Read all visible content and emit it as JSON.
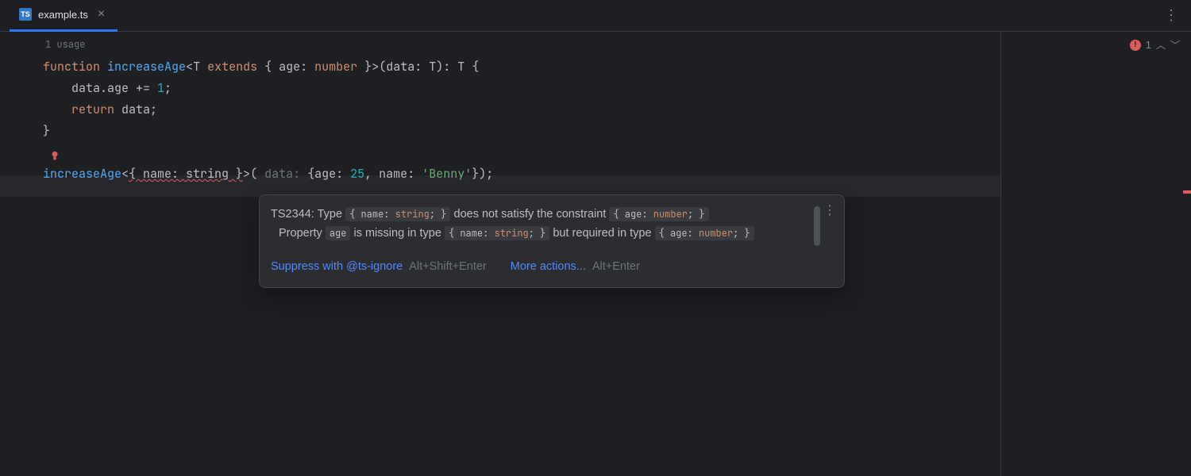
{
  "tab": {
    "icon_label": "TS",
    "filename": "example.ts"
  },
  "editor": {
    "usage_hint": "1 usage",
    "code": {
      "kw_function": "function",
      "fn_name": "increaseAge",
      "generic_open": "<",
      "T": "T",
      "kw_extends": "extends",
      "constraint_open": "{ ",
      "age_label": "age",
      "colon": ": ",
      "number_type": "number",
      "constraint_close": " }",
      "generic_close": ">",
      "params": "(data: ",
      "param_T": "T",
      "ret": "): ",
      "ret_T": "T",
      "brace_open": " {",
      "line2": "    data.age += ",
      "one": "1",
      "semi": ";",
      "line3_kw": "    return",
      "line3_rest": " data;",
      "brace_close": "}",
      "call_fn": "increaseAge",
      "call_generic_open": "<",
      "err_type": "{ name: string }",
      "call_generic_close": ">",
      "call_paren_open": "(",
      "inlay_data": " data: ",
      "obj_open": "{",
      "age_key": "age",
      "age_val": "25",
      "comma": ", ",
      "name_key": "name",
      "name_val": "'Benny'",
      "obj_close": "}",
      "call_close": ");"
    }
  },
  "rail": {
    "error_count": "1",
    "err_symbol": "!"
  },
  "popup": {
    "err_code": "TS2344",
    "msg1a": ": Type ",
    "chip1": "{ name: ",
    "chip1_kw": "string",
    "chip1_end": "; }",
    "msg1b": " does not satisfy the constraint ",
    "chip2": "{ age: ",
    "chip2_kw": "number",
    "chip2_end": "; }",
    "msg2a": "Property ",
    "chip3": "age",
    "msg2b": " is missing in type ",
    "chip4": "{ name: ",
    "chip4_kw": "string",
    "chip4_end": "; }",
    "msg2c": " but required in type ",
    "chip5": "{ age: ",
    "chip5_kw": "number",
    "chip5_end": "; }",
    "action1": "Suppress with @ts-ignore",
    "shortcut1": "Alt+Shift+Enter",
    "action2": "More actions...",
    "shortcut2": "Alt+Enter"
  }
}
